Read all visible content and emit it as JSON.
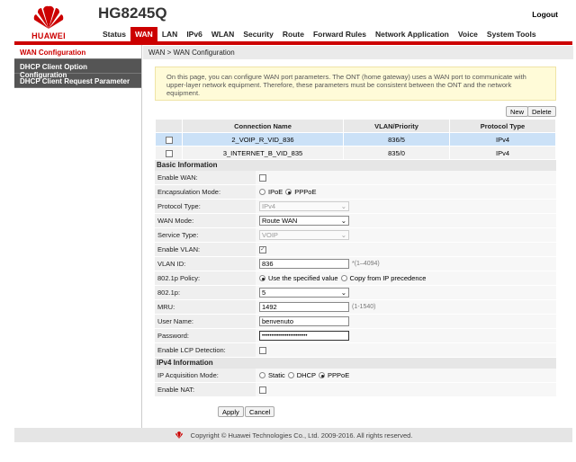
{
  "header": {
    "brand": "HUAWEI",
    "model": "HG8245Q",
    "logout": "Logout",
    "nav": [
      {
        "label": "Status"
      },
      {
        "label": "WAN",
        "active": true
      },
      {
        "label": "LAN"
      },
      {
        "label": "IPv6"
      },
      {
        "label": "WLAN"
      },
      {
        "label": "Security"
      },
      {
        "label": "Route"
      },
      {
        "label": "Forward Rules"
      },
      {
        "label": "Network Application"
      },
      {
        "label": "Voice"
      },
      {
        "label": "System Tools"
      }
    ]
  },
  "sidebar": {
    "items": [
      {
        "label": "WAN Configuration",
        "active": true
      },
      {
        "label": "DHCP Client Option Configuration"
      },
      {
        "label": "DHCP Client Request Parameter"
      }
    ]
  },
  "breadcrumb": "WAN > WAN Configuration",
  "notice": "On this page, you can configure WAN port parameters. The ONT (home gateway) uses a WAN port to communicate with upper-layer network equipment. Therefore, these parameters must be consistent between the ONT and the network equipment.",
  "buttons": {
    "new": "New",
    "delete": "Delete",
    "apply": "Apply",
    "cancel": "Cancel"
  },
  "table": {
    "headers": [
      "Connection Name",
      "VLAN/Priority",
      "Protocol Type"
    ],
    "rows": [
      {
        "name": "2_VOIP_R_VID_836",
        "vlan": "836/5",
        "protocol": "IPv4",
        "selected": true
      },
      {
        "name": "3_INTERNET_B_VID_835",
        "vlan": "835/0",
        "protocol": "IPv4"
      }
    ]
  },
  "form": {
    "basic_title": "Basic Information",
    "enable_wan": "Enable WAN:",
    "encap_label": "Encapsulation Mode:",
    "encap_ipoe": "IPoE",
    "encap_pppoe": "PPPoE",
    "protocol_label": "Protocol Type:",
    "protocol_value": "IPv4",
    "wanmode_label": "WAN Mode:",
    "wanmode_value": "Route WAN",
    "service_label": "Service Type:",
    "service_value": "VOIP",
    "enable_vlan": "Enable VLAN:",
    "vlan_label": "VLAN ID:",
    "vlan_value": "836",
    "vlan_hint": "*(1–4094)",
    "policy_label": "802.1p Policy:",
    "policy_specified": "Use the specified value",
    "policy_copy": "Copy from IP precedence",
    "p_label": "802.1p:",
    "p_value": "5",
    "mru_label": "MRU:",
    "mru_value": "1492",
    "mru_hint": "(1-1540)",
    "user_label": "User Name:",
    "user_value": "benvenuto",
    "pass_label": "Password:",
    "pass_value": "••••••••••••••••••••••••",
    "lcp_label": "Enable LCP Detection:",
    "ipv4_title": "IPv4 Information",
    "ipacq_label": "IP Acquisition Mode:",
    "ipacq_static": "Static",
    "ipacq_dhcp": "DHCP",
    "ipacq_pppoe": "PPPoE",
    "nat_label": "Enable NAT:"
  },
  "footer": "Copyright © Huawei Technologies Co., Ltd. 2009-2016. All rights reserved.",
  "colors": {
    "brand_red": "#cc0000",
    "sidebar_dark": "#555555",
    "selected_row": "#cbe1f7",
    "notice_bg": "#fffbd8"
  }
}
